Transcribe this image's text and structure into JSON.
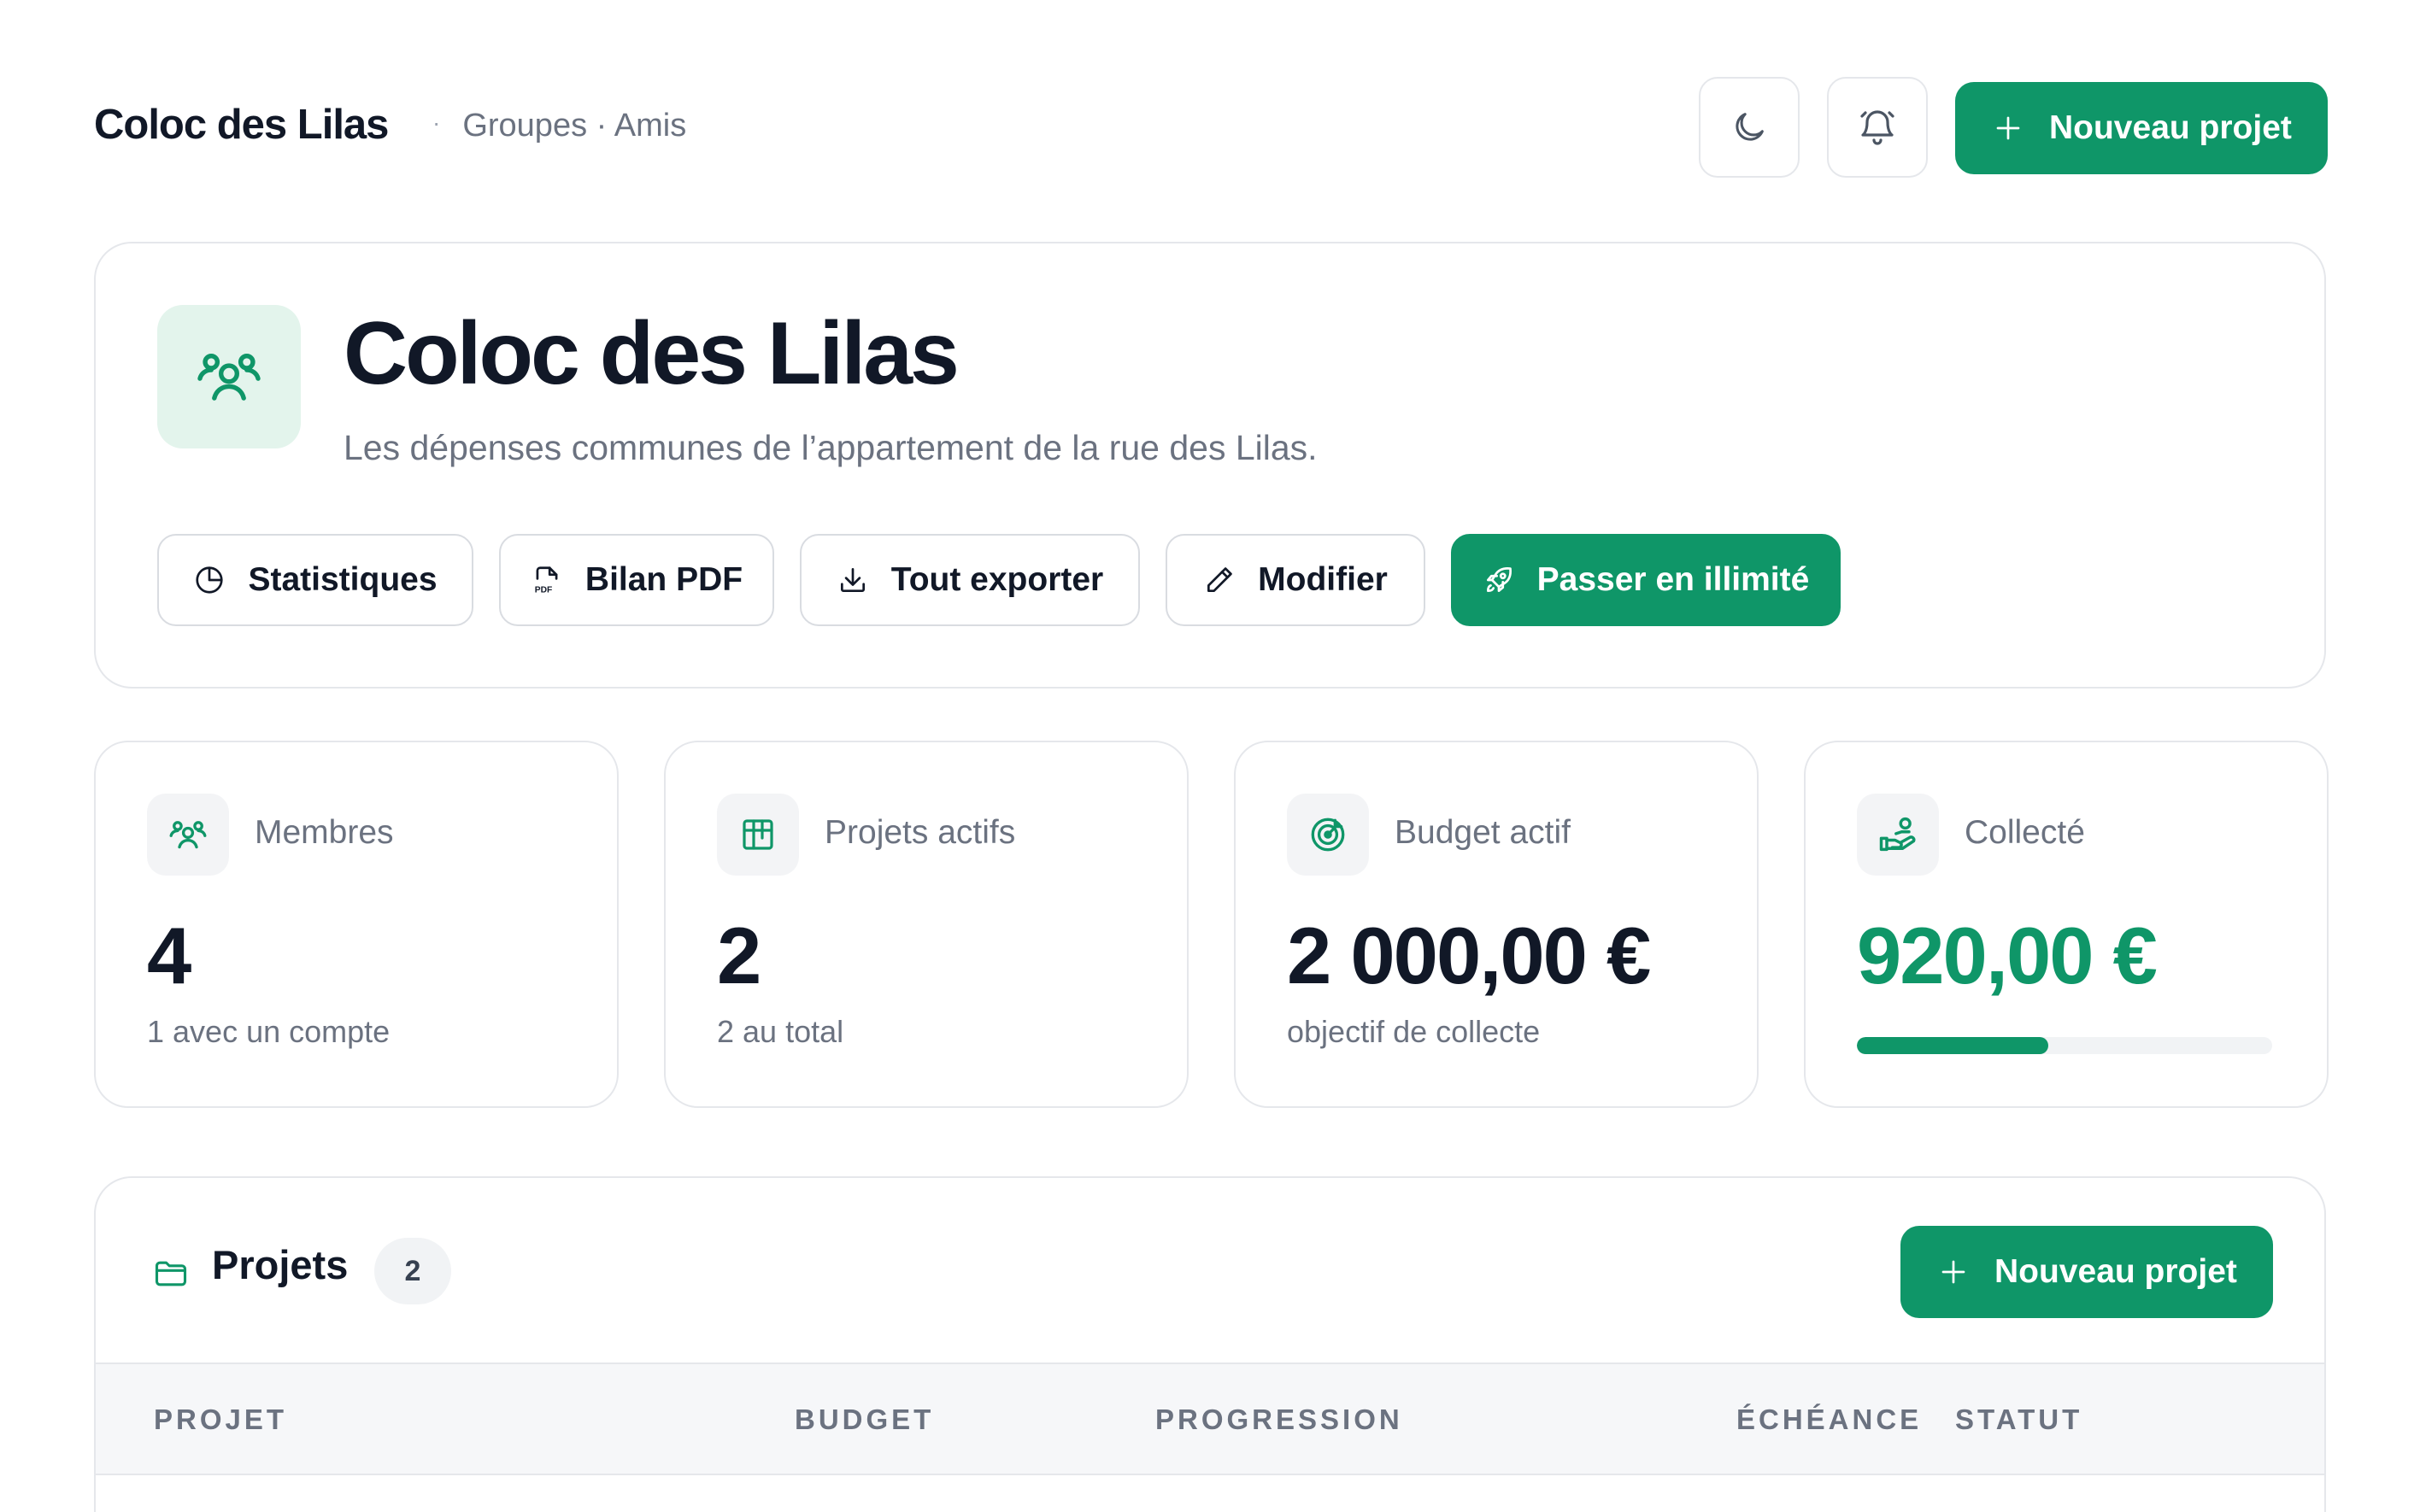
{
  "header": {
    "group_name": "Coloc des Lilas",
    "breadcrumb_separator": "·",
    "breadcrumb": "Groupes · Amis",
    "theme_toggle_icon": "moon-icon",
    "notifications_icon": "bell-icon",
    "new_project_label": "Nouveau projet"
  },
  "hero": {
    "icon": "users-group-icon",
    "title": "Coloc des Lilas",
    "description": "Les dépenses communes de l’appartement de la rue des Lilas.",
    "actions": [
      {
        "label": "Statistiques",
        "icon": "pie-chart-icon"
      },
      {
        "label": "Bilan PDF",
        "icon": "pdf-file-icon"
      },
      {
        "label": "Tout exporter",
        "icon": "download-icon"
      },
      {
        "label": "Modifier",
        "icon": "pencil-icon"
      },
      {
        "label": "Passer en illimité",
        "icon": "rocket-icon"
      }
    ]
  },
  "stats": [
    {
      "label": "Membres",
      "value": "4",
      "sub": "1 avec un compte",
      "icon": "users-group-icon"
    },
    {
      "label": "Projets actifs",
      "value": "2",
      "sub": "2 au total",
      "icon": "kanban-icon"
    },
    {
      "label": "Budget actif",
      "value": "2 000,00 €",
      "sub": "objectif de collecte",
      "icon": "target-icon"
    },
    {
      "label": "Collecté",
      "value": "920,00 €",
      "progress_fraction": 0.46,
      "icon": "hand-coins-icon"
    }
  ],
  "projects": {
    "title": "Projets",
    "count": "2",
    "icon": "folder-icon",
    "new_project_label": "Nouveau projet",
    "columns": [
      "PROJET",
      "BUDGET",
      "PROGRESSION",
      "ÉCHÉANCE",
      "STATUT"
    ]
  },
  "colors": {
    "accent": "#0f9668",
    "accent_light": "#e3f4ec",
    "text": "#111827",
    "muted": "#6b7280",
    "border": "#e5e7eb"
  }
}
